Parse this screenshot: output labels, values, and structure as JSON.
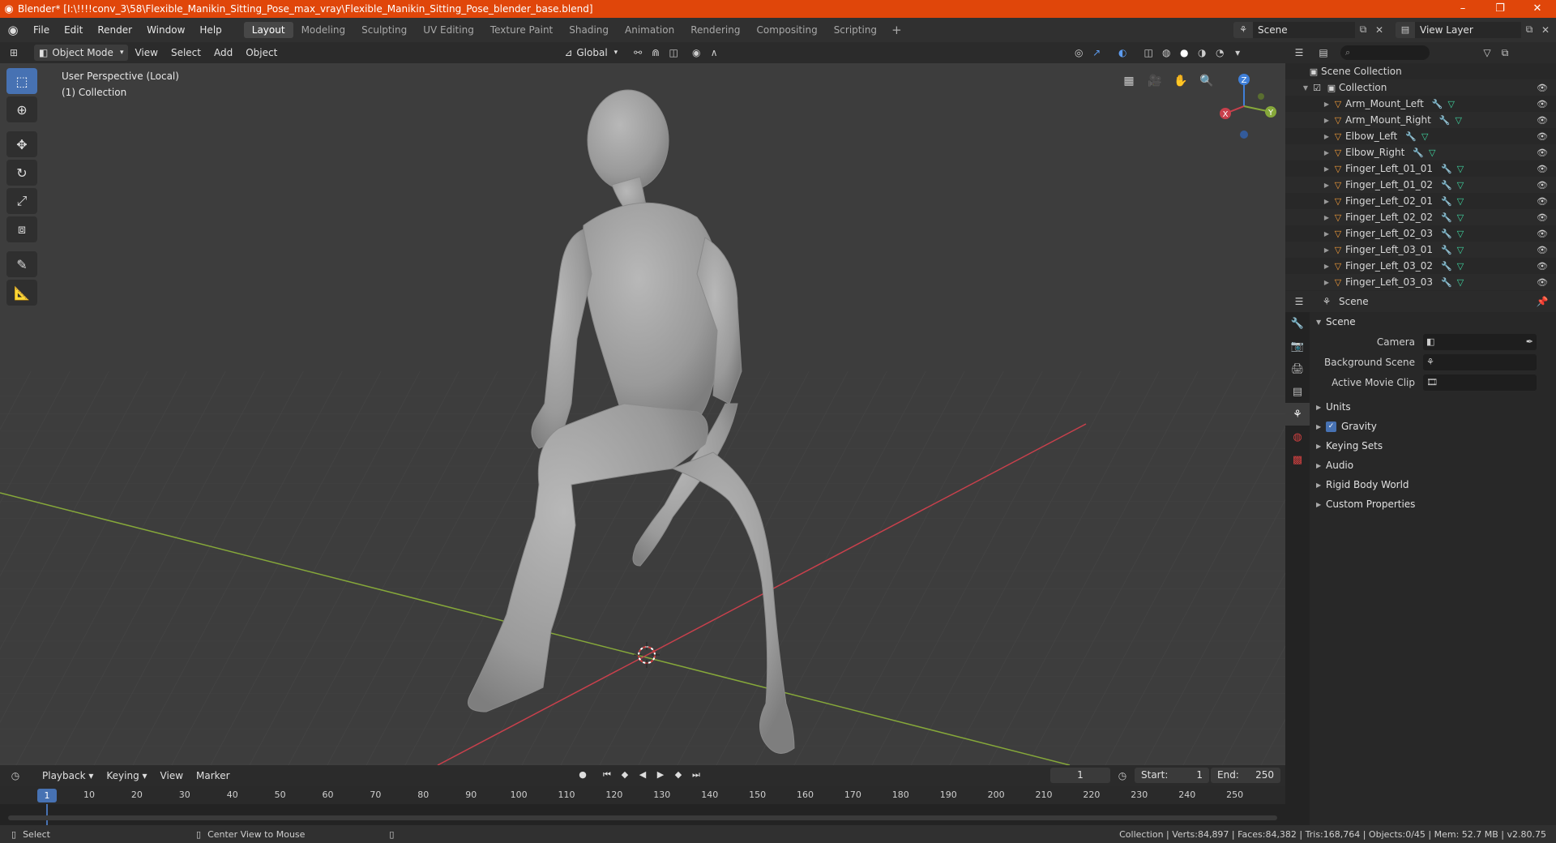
{
  "window": {
    "title": "Blender* [I:\\!!!!conv_3\\58\\Flexible_Manikin_Sitting_Pose_max_vray\\Flexible_Manikin_Sitting_Pose_blender_base.blend]",
    "controls": {
      "minimize": "–",
      "maximize": "❐",
      "close": "✕"
    }
  },
  "menubar": {
    "items": [
      "File",
      "Edit",
      "Render",
      "Window",
      "Help"
    ],
    "workspaces": [
      "Layout",
      "Modeling",
      "Sculpting",
      "UV Editing",
      "Texture Paint",
      "Shading",
      "Animation",
      "Rendering",
      "Compositing",
      "Scripting"
    ],
    "active_workspace": "Layout",
    "add_workspace": "+",
    "scene": "Scene",
    "view_layer": "View Layer"
  },
  "viewport_header": {
    "mode": "Object Mode",
    "menus": [
      "View",
      "Select",
      "Add",
      "Object"
    ],
    "orientation": "Global"
  },
  "viewport": {
    "perspective": "User Perspective (Local)",
    "collection": "(1) Collection",
    "gizmo": {
      "x": "X",
      "y": "Y",
      "z": "Z"
    },
    "colors": {
      "bg": "#3d3d3d",
      "x_axis": "#c8404c",
      "y_axis": "#86a83a",
      "z_axis": "#3f7fd8"
    }
  },
  "outliner": {
    "scene_collection": "Scene Collection",
    "collection": "Collection",
    "objects": [
      "Arm_Mount_Left",
      "Arm_Mount_Right",
      "Elbow_Left",
      "Elbow_Right",
      "Finger_Left_01_01",
      "Finger_Left_01_02",
      "Finger_Left_02_01",
      "Finger_Left_02_02",
      "Finger_Left_02_03",
      "Finger_Left_03_01",
      "Finger_Left_03_02",
      "Finger_Left_03_03"
    ]
  },
  "properties": {
    "context": "Scene",
    "section": "Scene",
    "fields": [
      {
        "label": "Camera"
      },
      {
        "label": "Background Scene"
      },
      {
        "label": "Active Movie Clip"
      }
    ],
    "panels": [
      "Units",
      "Gravity",
      "Keying Sets",
      "Audio",
      "Rigid Body World",
      "Custom Properties"
    ],
    "gravity_checked": true
  },
  "timeline": {
    "menus": [
      "Playback",
      "Keying",
      "View",
      "Marker"
    ],
    "current_frame": "1",
    "start_label": "Start:",
    "start": "1",
    "end_label": "End:",
    "end": "250",
    "ticks": [
      "10",
      "20",
      "30",
      "40",
      "50",
      "60",
      "70",
      "80",
      "90",
      "100",
      "110",
      "120",
      "130",
      "140",
      "150",
      "160",
      "170",
      "180",
      "190",
      "200",
      "210",
      "220",
      "230",
      "240",
      "250"
    ],
    "cursor_frame": "1"
  },
  "statusbar": {
    "select": "Select",
    "center_view": "Center View to Mouse",
    "stats": "Collection | Verts:84,897 | Faces:84,382 | Tris:168,764 | Objects:0/45 | Mem: 52.7 MB | v2.80.75"
  }
}
